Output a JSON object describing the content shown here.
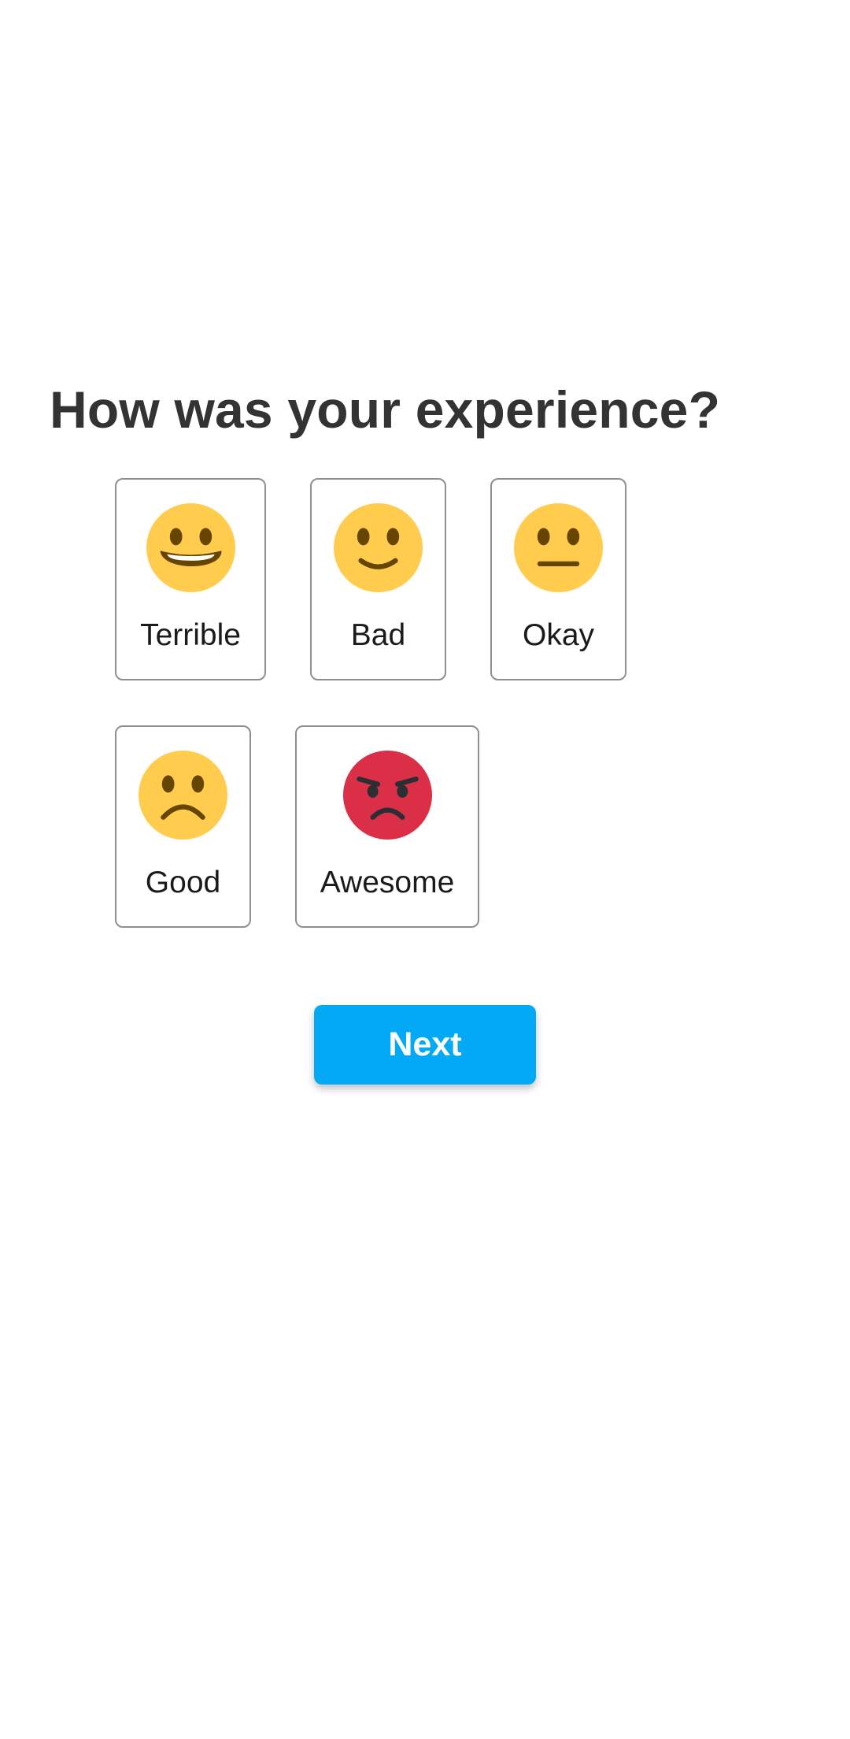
{
  "question": "How was your experience?",
  "options": [
    {
      "label": "Terrible",
      "face": "grinning-face-icon"
    },
    {
      "label": "Bad",
      "face": "slightly-smiling-face-icon"
    },
    {
      "label": "Okay",
      "face": "neutral-face-icon"
    },
    {
      "label": "Good",
      "face": "frowning-face-icon"
    },
    {
      "label": "Awesome",
      "face": "angry-red-face-icon"
    }
  ],
  "next_button": {
    "label": "Next"
  },
  "colors": {
    "title": "#333333",
    "emoji_yellow": "#FFCC4D",
    "emoji_feature": "#664500",
    "angry_red": "#DA2F47",
    "angry_feature": "#292F33",
    "card_border": "#8F8F8F",
    "button": "#03A9F4",
    "button_text": "#FFFFFF"
  }
}
